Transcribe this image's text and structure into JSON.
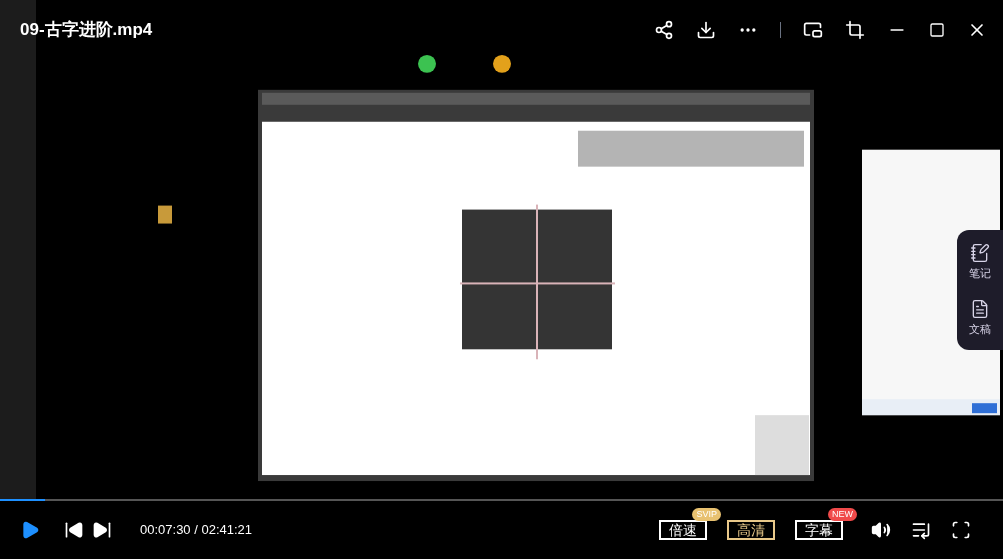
{
  "title": "09-古字进阶.mp4",
  "side_panel": [
    {
      "label": "笔记",
      "kind": "note"
    },
    {
      "label": "文稿",
      "kind": "doc"
    }
  ],
  "progress": {
    "level": 0.045
  },
  "player": {
    "time": "00:07:30 / 02:41:21",
    "playing": false
  },
  "buttons": [
    {
      "label": "倍速",
      "selected": false,
      "badge": {
        "text": "SVIP",
        "color": "#e8c170"
      }
    },
    {
      "label": "高清",
      "selected": true
    },
    {
      "label": "字幕",
      "selected": false,
      "badge": {
        "text": "NEW",
        "color": "#f04a4a"
      }
    }
  ]
}
